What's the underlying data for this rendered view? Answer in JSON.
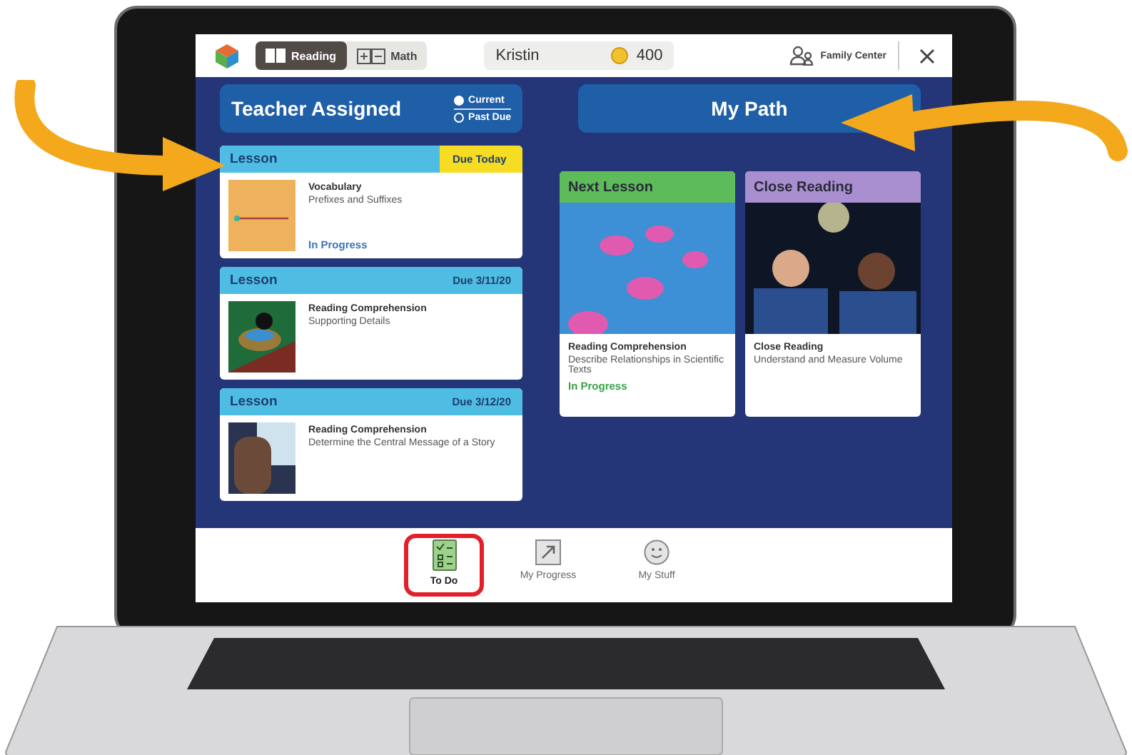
{
  "top_bar": {
    "subjects": [
      {
        "label": "Reading",
        "kind": "reading",
        "selected": true
      },
      {
        "label": "Math",
        "kind": "math",
        "selected": false
      }
    ],
    "student": "Kristin",
    "coins": "400",
    "family_center": "Family Center"
  },
  "teacher_assigned": {
    "title": "Teacher Assigned",
    "filters": [
      {
        "label": "Current",
        "selected": true
      },
      {
        "label": "Past Due",
        "selected": false
      }
    ],
    "assignments": [
      {
        "type": "Lesson",
        "due": "Due Today",
        "due_today": true,
        "kind": "word",
        "subject": "Vocabulary",
        "topic": "Prefixes and Suffixes",
        "status": "In Progress"
      },
      {
        "type": "Lesson",
        "due": "Due 3/11/20",
        "due_today": false,
        "kind": "bird",
        "subject": "Reading Comprehension",
        "topic": "Supporting Details"
      },
      {
        "type": "Lesson",
        "due": "Due 3/12/20",
        "due_today": false,
        "kind": "person",
        "subject": "Reading Comprehension",
        "topic": "Determine the Central Message of a Story"
      }
    ]
  },
  "my_path": {
    "title": "My Path",
    "cards": [
      {
        "header": "Next Lesson",
        "color": "#5dbb5a",
        "kind": "jellyfish",
        "subject": "Reading Comprehension",
        "topic": "Describe Relationships in Scientific Texts",
        "status": "In Progress"
      },
      {
        "header": "Close Reading",
        "color": "#a98fcf",
        "kind": "astronauts",
        "subject": "Close Reading",
        "topic": "Understand and Measure Volume"
      }
    ]
  },
  "bottom_nav": [
    {
      "label": "To Do",
      "kind": "todo",
      "selected": true
    },
    {
      "label": "My Progress",
      "kind": "progress",
      "selected": false
    },
    {
      "label": "My Stuff",
      "kind": "stuff",
      "selected": false
    }
  ]
}
